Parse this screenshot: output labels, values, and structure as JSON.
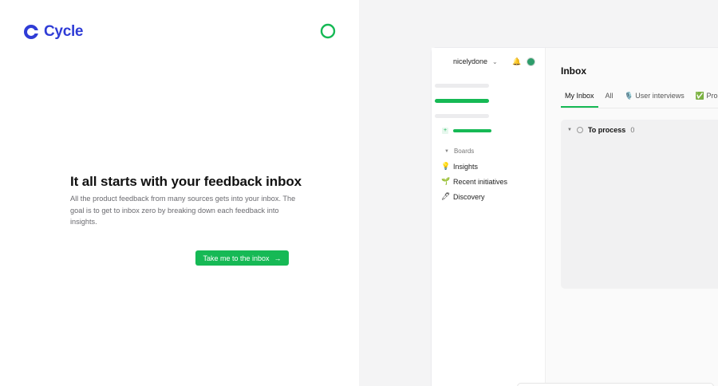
{
  "brand": {
    "name": "Cycle",
    "color": "#2f3cd6"
  },
  "accent": "#16b955",
  "onboarding": {
    "headline": "It all starts with your feedback inbox",
    "description": "All the product feedback from many sources gets into your inbox. The goal is to get to inbox zero by breaking down each feedback into insights.",
    "cta_label": "Take me to the inbox"
  },
  "mock_app": {
    "workspace": "nicelydone",
    "boards_label": "Boards",
    "nav_items": [
      {
        "label": "Insights",
        "icon": "lightbulb-icon",
        "glyph": "💡"
      },
      {
        "label": "Recent initiatives",
        "icon": "seedling-icon",
        "glyph": "🌱"
      },
      {
        "label": "Discovery",
        "icon": "pen-icon",
        "glyph": "🖊"
      }
    ],
    "inbox_title": "Inbox",
    "tabs": [
      {
        "label": "My Inbox"
      },
      {
        "label": "All"
      },
      {
        "label": "🎙️ User interviews"
      },
      {
        "label": "✅ Proc"
      }
    ],
    "group": {
      "label": "To process",
      "count": "0"
    }
  }
}
